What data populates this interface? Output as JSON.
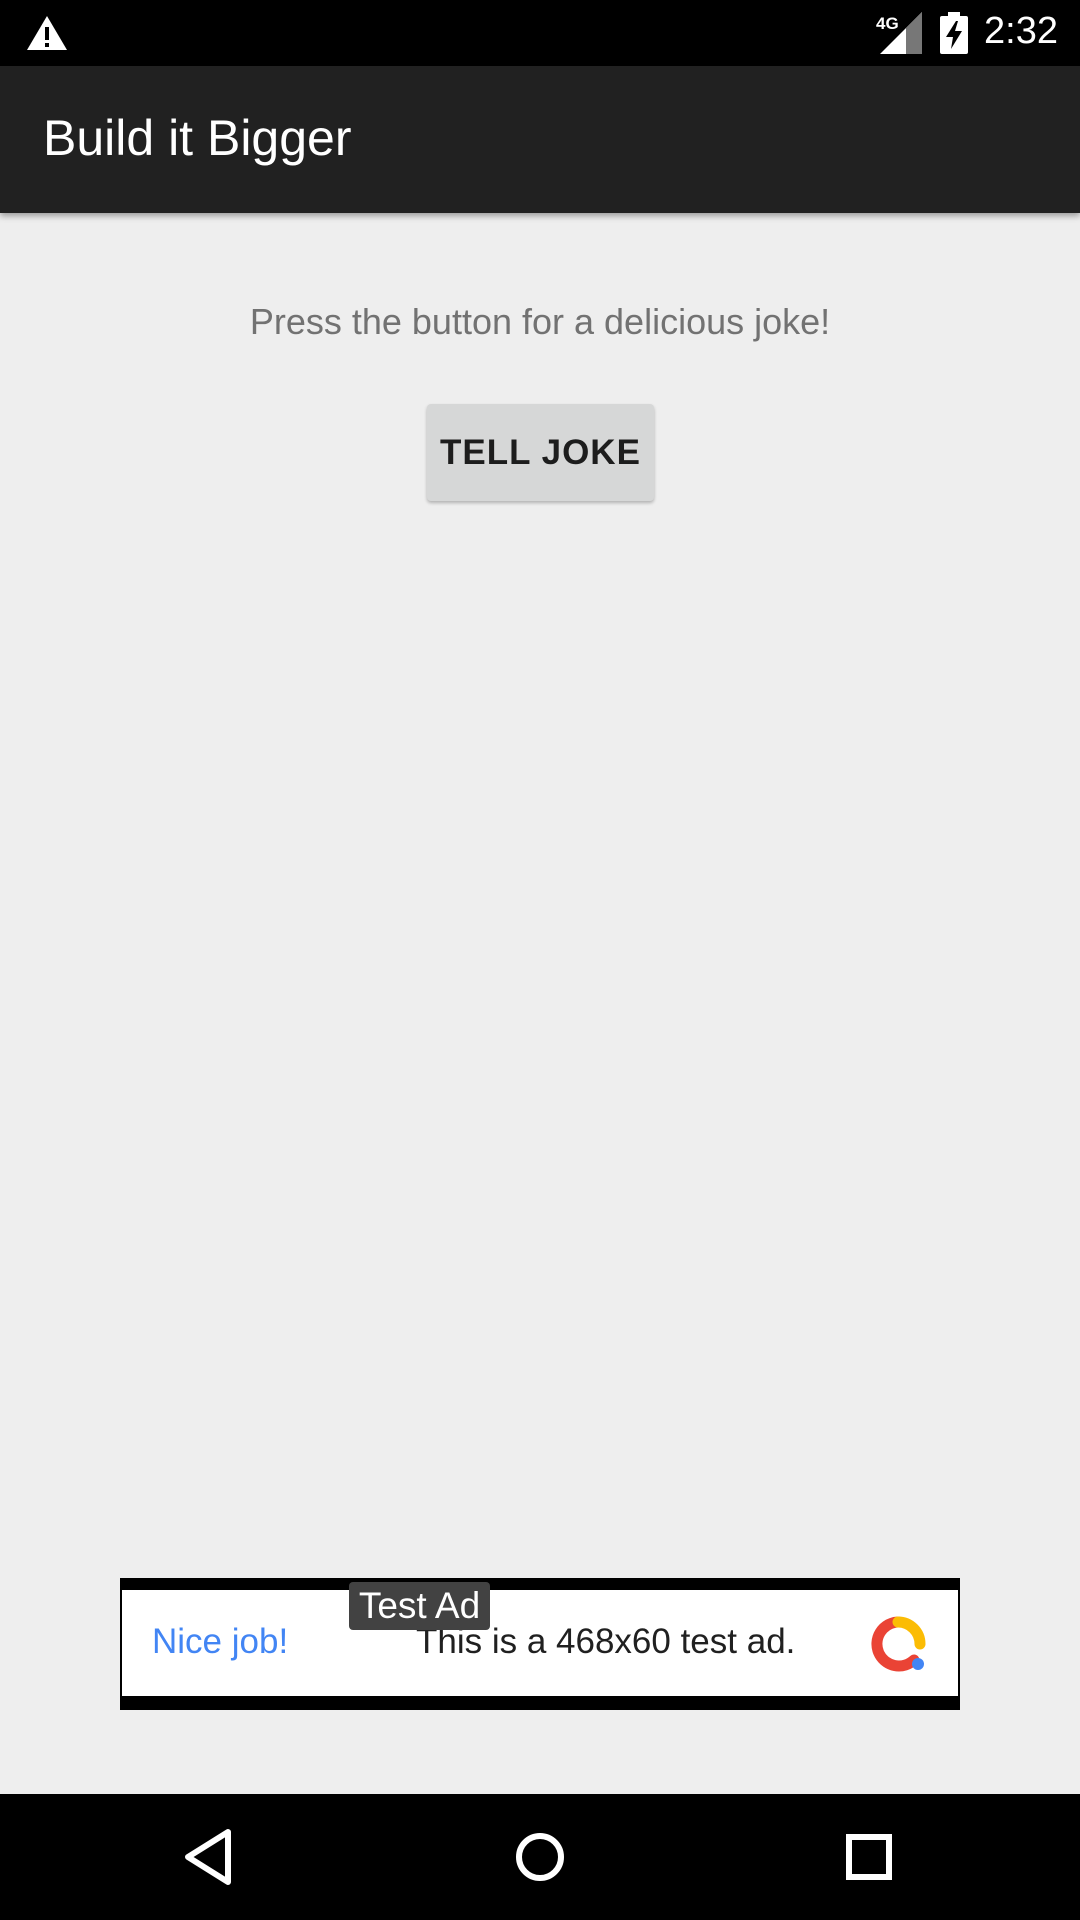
{
  "status_bar": {
    "time": "2:32",
    "network_label": "4G",
    "icons": [
      "warning-icon",
      "signal-icon",
      "battery-charging-icon"
    ]
  },
  "app_bar": {
    "title": "Build it Bigger"
  },
  "main": {
    "prompt": "Press the button for a delicious joke!",
    "button_label": "TELL JOKE"
  },
  "ad": {
    "badge": "Test Ad",
    "headline": "Nice job!",
    "body": "This is a 468x60 test ad.",
    "icon": "admob-logo-icon",
    "colors": {
      "headline": "#4285f4",
      "logo_red": "#ea4335",
      "logo_yellow": "#fbbc04",
      "logo_blue": "#4285f4"
    }
  },
  "nav_bar": {
    "icons": [
      "back-icon",
      "home-icon",
      "recents-icon"
    ]
  },
  "colors": {
    "app_bar": "#212121",
    "background": "#eeeeee",
    "button": "#d6d7d7"
  }
}
